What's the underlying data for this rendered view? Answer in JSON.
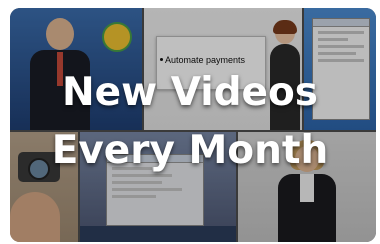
{
  "banner": {
    "line1": "New Videos",
    "line2": "Every Month"
  },
  "tiles": {
    "slide_bullet": "Automate payments"
  },
  "colors": {
    "text": "#ffffff",
    "card_bg": "#3a3a3a"
  }
}
